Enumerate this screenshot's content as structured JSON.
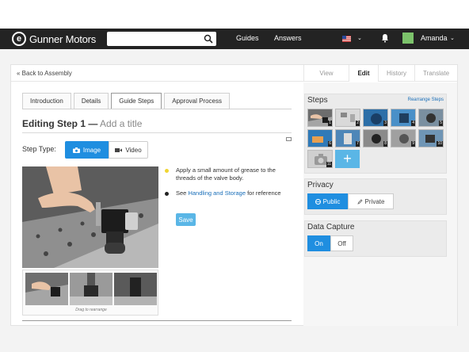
{
  "nav": {
    "brand": "Gunner Motors",
    "logo_letter": "e",
    "search_placeholder": "",
    "links": [
      "Guides",
      "Answers"
    ],
    "user_name": "Amanda"
  },
  "header": {
    "back_link": "« Back to Assembly",
    "modes": [
      "View",
      "Edit",
      "History",
      "Translate"
    ],
    "active_mode": "Edit"
  },
  "editor": {
    "tabs": [
      "Introduction",
      "Details",
      "Guide Steps",
      "Approval Process"
    ],
    "active_tab": "Guide Steps",
    "step_title_prefix": "Editing Step 1 —",
    "step_title_placeholder": "Add a title",
    "step_type_label": "Step Type:",
    "type_image": "Image",
    "type_video": "Video",
    "drag_note": "Drag to rearrange",
    "bullets": [
      {
        "color": "#f0d532",
        "text": "Apply a small amount of grease to the threads of the valve body."
      },
      {
        "color": "#222222",
        "pre": "See ",
        "link": "Handling and Storage",
        "post": " for reference"
      }
    ],
    "save_label": "Save"
  },
  "sidebar": {
    "steps_title": "Steps",
    "rearrange_label": "Rearrange Steps",
    "step_numbers": [
      "1",
      "2",
      "3",
      "4",
      "5",
      "6",
      "7",
      "8",
      "9",
      "10",
      "11"
    ],
    "add_icon": "+",
    "privacy_title": "Privacy",
    "privacy_public": "Public",
    "privacy_private": "Private",
    "capture_title": "Data Capture",
    "capture_on": "On",
    "capture_off": "Off"
  },
  "colors": {
    "accent": "#1f8ee0",
    "save": "#5ab6e6",
    "nav_bg": "#232323"
  }
}
